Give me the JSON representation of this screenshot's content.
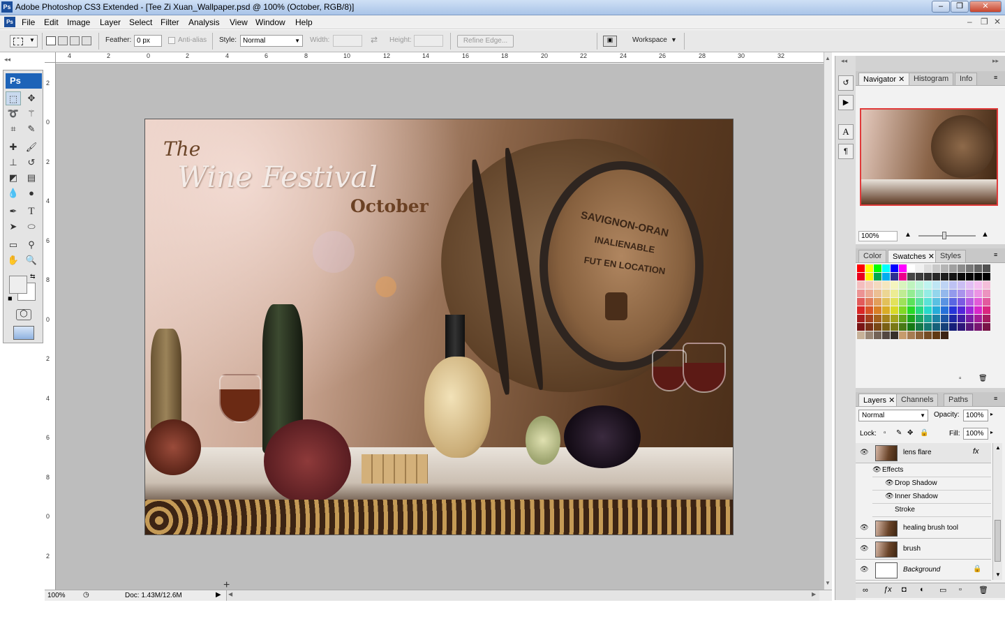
{
  "window": {
    "title": "Adobe Photoshop CS3 Extended - [Tee Zi Xuan_Wallpaper.psd @ 100% (October, RGB/8)]",
    "app_icon": "Ps"
  },
  "menu": [
    "File",
    "Edit",
    "Image",
    "Layer",
    "Select",
    "Filter",
    "Analysis",
    "View",
    "Window",
    "Help"
  ],
  "options": {
    "feather_label": "Feather:",
    "feather_value": "0 px",
    "antialias_label": "Anti-alias",
    "style_label": "Style:",
    "style_value": "Normal",
    "width_label": "Width:",
    "height_label": "Height:",
    "refine_edge": "Refine Edge...",
    "workspace": "Workspace"
  },
  "toolbox": {
    "logo": "Ps"
  },
  "rulers": {
    "top": [
      "4",
      "2",
      "0",
      "2",
      "4",
      "6",
      "8",
      "10",
      "12",
      "14",
      "16",
      "18",
      "20",
      "22",
      "24",
      "26",
      "28",
      "30",
      "32"
    ],
    "left": [
      "2",
      "0",
      "2",
      "4",
      "6",
      "8",
      "0",
      "2",
      "4",
      "6",
      "8",
      "0",
      "2"
    ]
  },
  "artwork": {
    "the": "The",
    "festival": "Wine Festival",
    "month": "October",
    "barrel_lines": [
      "SAVIGNON-ORAN",
      "INALIENABLE",
      "FUT EN LOCATION"
    ]
  },
  "status": {
    "zoom": "100%",
    "doc": "Doc: 1.43M/12.6M"
  },
  "navigator": {
    "tabs": [
      "Navigator",
      "Histogram",
      "Info"
    ],
    "zoom": "100%"
  },
  "swatches_panel": {
    "tabs": [
      "Color",
      "Swatches",
      "Styles"
    ]
  },
  "layers_panel": {
    "tabs": [
      "Layers",
      "Channels",
      "Paths"
    ],
    "blend_mode": "Normal",
    "opacity_label": "Opacity:",
    "opacity": "100%",
    "lock_label": "Lock:",
    "fill_label": "Fill:",
    "fill": "100%",
    "layers": [
      {
        "name": "lens flare",
        "fx": "fx"
      },
      {
        "name": "healing brush tool"
      },
      {
        "name": "brush"
      },
      {
        "name": "Background"
      }
    ],
    "effects_label": "Effects",
    "effects": [
      "Drop Shadow",
      "Inner Shadow",
      "Stroke"
    ]
  },
  "colors": {
    "accent": "#1d63b8",
    "canvas_bg": "#bdbdbd",
    "panel_bg": "#f2f2f2"
  }
}
